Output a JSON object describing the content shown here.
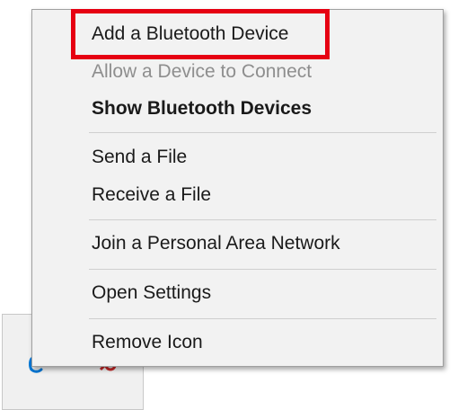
{
  "menu": {
    "items": [
      {
        "label": "Add a Bluetooth Device",
        "enabled": true,
        "bold": false,
        "highlighted": true
      },
      {
        "label": "Allow a Device to Connect",
        "enabled": false,
        "bold": false
      },
      {
        "label": "Show Bluetooth Devices",
        "enabled": true,
        "bold": true
      },
      {
        "label": "Send a File",
        "enabled": true,
        "bold": false
      },
      {
        "label": "Receive a File",
        "enabled": true,
        "bold": false
      },
      {
        "label": "Join a Personal Area Network",
        "enabled": true,
        "bold": false
      },
      {
        "label": "Open Settings",
        "enabled": true,
        "bold": false
      },
      {
        "label": "Remove Icon",
        "enabled": true,
        "bold": false
      }
    ]
  },
  "tray": {
    "icons": [
      "bluetooth-icon",
      "red-status-icon"
    ]
  },
  "colors": {
    "highlight_border": "#e60012",
    "menu_background": "#f2f2f2",
    "disabled_text": "#8e8e8e",
    "bluetooth_blue": "#0078d7"
  }
}
